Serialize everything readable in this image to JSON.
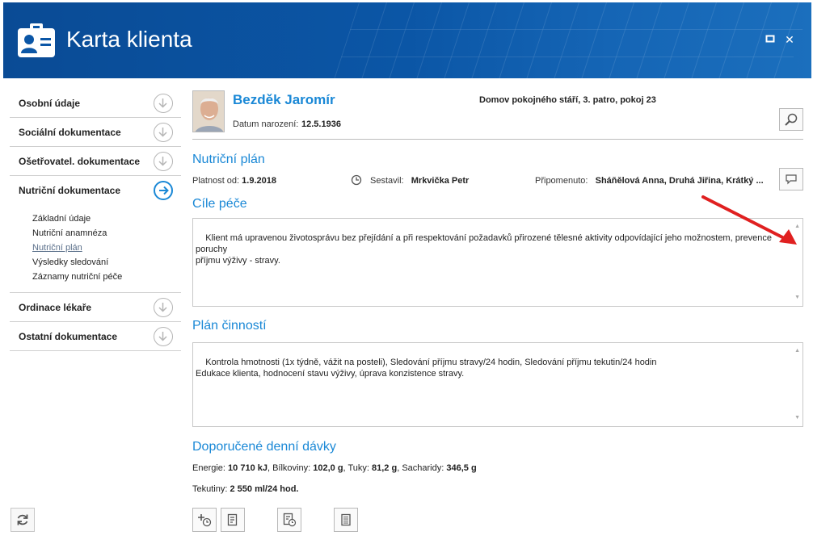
{
  "window": {
    "title": "Karta klienta",
    "restore_glyph": "▫",
    "close_glyph": "✕"
  },
  "sidebar": {
    "sections": [
      {
        "label": "Osobní údaje",
        "state": "collapsed"
      },
      {
        "label": "Sociální dokumentace",
        "state": "collapsed"
      },
      {
        "label": "Ošetřovatel. dokumentace",
        "state": "collapsed"
      },
      {
        "label": "Nutriční dokumentace",
        "state": "active"
      },
      {
        "label": "Ordinace lékaře",
        "state": "collapsed"
      },
      {
        "label": "Ostatní dokumentace",
        "state": "collapsed"
      }
    ],
    "subitems": [
      "Základní údaje",
      "Nutriční anamnéza",
      "Nutriční plán",
      "Výsledky sledování",
      "Záznamy nutriční péče"
    ],
    "current_subitem": "Nutriční plán"
  },
  "client": {
    "name": "Bezděk Jaromír",
    "dob_label": "Datum narození:",
    "dob": "12.5.1936",
    "location": "Domov pokojného stáří, 3. patro, pokoj 23"
  },
  "plan": {
    "title": "Nutriční plán",
    "validity_label": "Platnost od:",
    "validity": "1.9.2018",
    "author_label": "Sestavil:",
    "author": "Mrkvička Petr",
    "reminded_label": "Připomenuto:",
    "reminded": "Sháňělová Anna, Druhá Jiřina, Krátký ..."
  },
  "goals": {
    "title": "Cíle péče",
    "text": "Klient má upravenou životosprávu bez přejídání a při respektování požadavků přirozené tělesné aktivity odpovídající jeho možnostem, prevence poruchy\npříjmu výživy - stravy."
  },
  "activities": {
    "title": "Plán činností",
    "text": "Kontrola hmotnosti (1x týdně, vážit na posteli), Sledování příjmu stravy/24 hodin, Sledování příjmu tekutin/24 hodin\nEdukace klienta, hodnocení stavu výživy, úprava konzistence stravy."
  },
  "doses": {
    "title": "Doporučené denní dávky",
    "energy_label": "Energie:",
    "energy": "10 710 kJ",
    "protein_label": ", Bílkoviny:",
    "protein": "102,0 g",
    "fat_label": ", Tuky:",
    "fat": "81,2 g",
    "carbs_label": ", Sacharidy:",
    "carbs": "346,5 g",
    "fluids_label": "Tekutiny:",
    "fluids": "2 550 ml/24 hod."
  },
  "colors": {
    "header": "#0b56a6",
    "accent": "#1a88d6",
    "annotation_arrow": "#e02020"
  }
}
